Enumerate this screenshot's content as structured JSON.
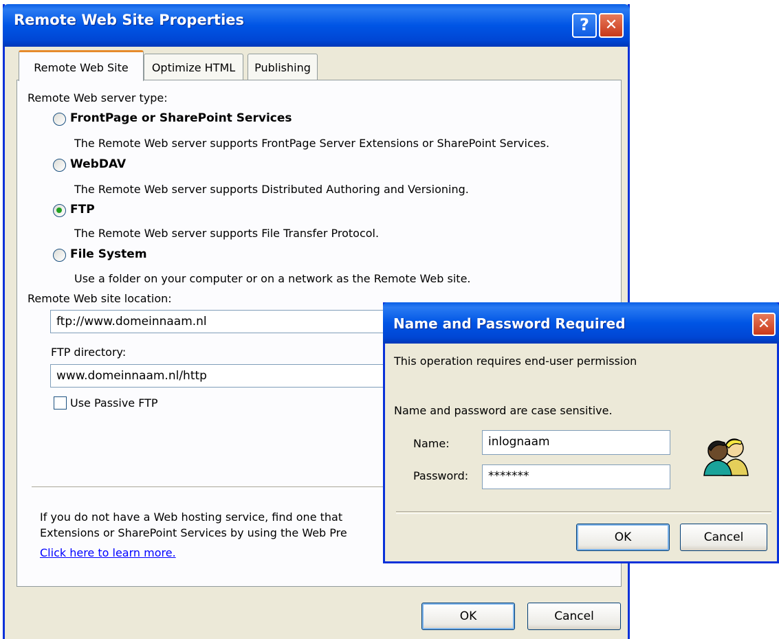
{
  "main": {
    "title": "Remote Web Site Properties",
    "help_glyph": "?",
    "close_glyph": "✕",
    "tabs": [
      {
        "label": "Remote Web Site"
      },
      {
        "label": "Optimize HTML"
      },
      {
        "label": "Publishing"
      }
    ],
    "server_type_label": "Remote Web server type:",
    "options": [
      {
        "label": "FrontPage or SharePoint Services",
        "desc": "The Remote Web server supports FrontPage Server Extensions or SharePoint Services.",
        "checked": false
      },
      {
        "label": "WebDAV",
        "desc": "The Remote Web server supports Distributed Authoring and Versioning.",
        "checked": false
      },
      {
        "label": "FTP",
        "desc": "The Remote Web server supports File Transfer Protocol.",
        "checked": true
      },
      {
        "label": "File System",
        "desc": "Use a folder on your computer or on a network as the Remote Web site.",
        "checked": false
      }
    ],
    "location_label": "Remote Web site location:",
    "location_value": "ftp://www.domeinnaam.nl",
    "ftp_dir_label": "FTP directory:",
    "ftp_dir_value": "www.domeinnaam.nl/http",
    "passive_label": "Use Passive FTP",
    "passive_checked": false,
    "hosting_line1": "If you do not have a Web hosting service, find one that",
    "hosting_line2": "Extensions or SharePoint Services by using the Web Pre",
    "learn_more": "Click here to learn more.",
    "ok": "OK",
    "cancel": "Cancel"
  },
  "popup": {
    "title": "Name and Password Required",
    "close_glyph": "✕",
    "message1": "This operation requires end-user permission",
    "message2": "Name and password are case sensitive.",
    "name_label": "Name:",
    "name_value": "inlognaam",
    "password_label": "Password:",
    "password_value": "*******",
    "ok": "OK",
    "cancel": "Cancel",
    "icon": "users-icon"
  }
}
